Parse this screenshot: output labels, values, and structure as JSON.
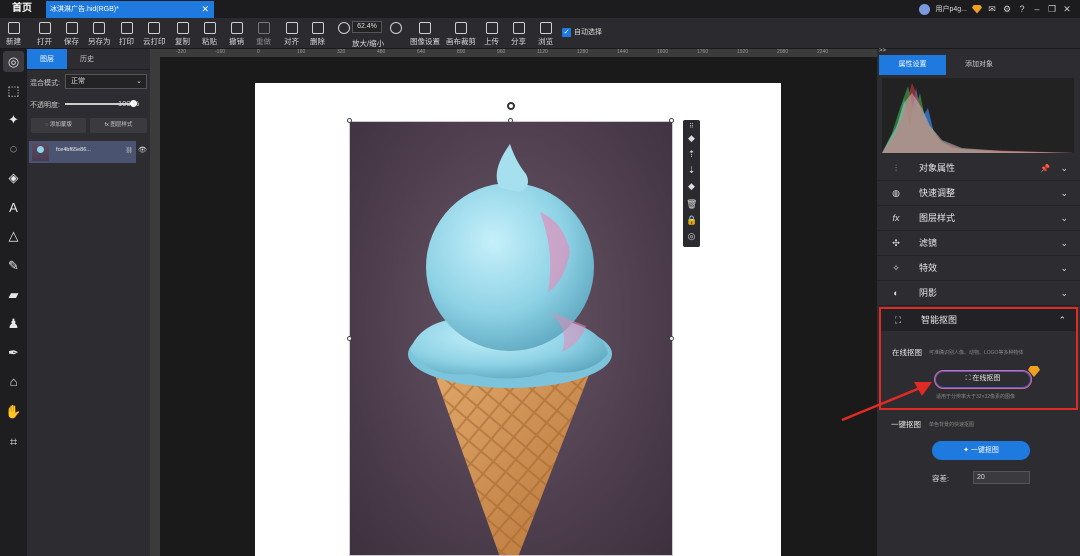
{
  "tabs": {
    "home": "首页",
    "document": "冰淇淋广告.hid(RGB)*",
    "close": "✕"
  },
  "user": {
    "name": "用户p4g...",
    "icons": [
      "avatar",
      "gem-icon",
      "mail-icon",
      "settings-icon",
      "help-icon",
      "minimize-icon",
      "restore-icon",
      "close-icon"
    ]
  },
  "toolbar": {
    "items": [
      {
        "label": "新建",
        "icon": "new-icon"
      },
      {
        "label": "打开",
        "icon": "open-icon"
      },
      {
        "label": "保存",
        "icon": "save-icon"
      },
      {
        "label": "另存为",
        "icon": "save-as-icon"
      },
      {
        "label": "打印",
        "icon": "print-icon"
      },
      {
        "label": "云打印",
        "icon": "cloud-print-icon"
      },
      {
        "label": "复制",
        "icon": "copy-icon"
      },
      {
        "label": "粘贴",
        "icon": "paste-icon"
      },
      {
        "label": "撤销",
        "icon": "undo-icon"
      },
      {
        "label": "重做",
        "icon": "redo-icon",
        "disabled": true
      },
      {
        "label": "对齐",
        "icon": "align-icon"
      },
      {
        "label": "删除",
        "icon": "delete-icon"
      },
      {
        "label": "放大/缩小",
        "icon": "zoom-icon"
      },
      {
        "label": "图像设置",
        "icon": "image-settings-icon"
      },
      {
        "label": "画布裁剪",
        "icon": "canvas-crop-icon"
      },
      {
        "label": "上传",
        "icon": "upload-icon"
      },
      {
        "label": "分享",
        "icon": "share-icon"
      },
      {
        "label": "浏览",
        "icon": "browse-icon"
      }
    ],
    "zoom_value": "62.4%",
    "auto_select_label": "自动选择",
    "auto_select_checked": true
  },
  "left_tools": [
    "select-icon",
    "marquee-icon",
    "magic-wand-icon",
    "lasso-icon",
    "fill-icon",
    "text-icon",
    "shape-icon",
    "brush-icon",
    "eraser-icon",
    "stamp-icon",
    "pen-icon",
    "path-select-icon",
    "hand-icon",
    "crop-icon"
  ],
  "layers_panel": {
    "tabs": [
      "图层",
      "历史"
    ],
    "blend_mode_label": "混合模式:",
    "blend_mode_value": "正常",
    "opacity_label": "不透明度:",
    "opacity_value": "100 %",
    "opacity_fraction": 1.0,
    "btn_mask": "添加蒙版",
    "btn_style": "图层样式",
    "layer_name": "fce4bf65e86..."
  },
  "rulers": {
    "ticks": [
      "-320",
      "-160",
      "0",
      "160",
      "320",
      "480",
      "640",
      "800",
      "960",
      "1120",
      "1280",
      "1440",
      "1600",
      "1760",
      "1920",
      "2080",
      "2240"
    ]
  },
  "right_panel": {
    "collapse": ">>",
    "tabs": [
      "属性设置",
      "添加对象"
    ],
    "sections": [
      {
        "label": "对象属性",
        "icon": "sliders-icon",
        "pinned": true
      },
      {
        "label": "快速调整",
        "icon": "adjust-icon"
      },
      {
        "label": "图层样式",
        "icon": "fx-icon"
      },
      {
        "label": "滤镜",
        "icon": "filter-icon"
      },
      {
        "label": "特效",
        "icon": "effects-icon"
      },
      {
        "label": "阴影",
        "icon": "shadow-icon"
      }
    ],
    "smart_cutout": {
      "title": "智能抠图",
      "online_title": "在线抠图",
      "online_desc": "可准确识别人像、动物、LOGO等多种物体",
      "online_button": "在线抠图",
      "online_note": "适用于分辨率大于32×32像素的图像",
      "oneclick_title": "一键抠图",
      "oneclick_desc": "单色背景的快速抠图",
      "oneclick_button": "一键抠图",
      "tolerance_label": "容差:",
      "tolerance_value": "20"
    }
  },
  "colors": {
    "accent": "#1f7ae0",
    "highlight_border": "#e02a24",
    "panel_bg": "#2d2d31"
  }
}
